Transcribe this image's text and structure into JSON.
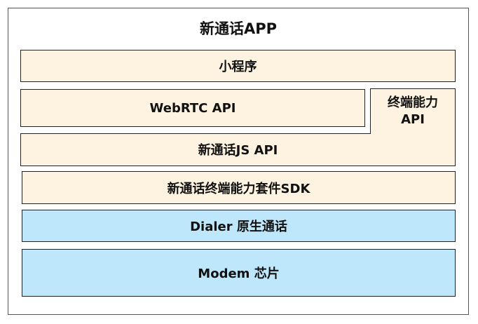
{
  "app_title": "新通话APP",
  "layers": {
    "mini_program": "小程序",
    "webrtc_api": "WebRTC API",
    "capability_api_line1": "终端能力",
    "capability_api_line2": "API",
    "js_api": "新通话JS API",
    "sdk": "新通话终端能力套件SDK",
    "dialer": "Dialer 原生通话",
    "modem": "Modem 芯片"
  },
  "colors": {
    "app_layer_fill": "#fdf3e0",
    "system_layer_fill": "#bfe7fb"
  }
}
